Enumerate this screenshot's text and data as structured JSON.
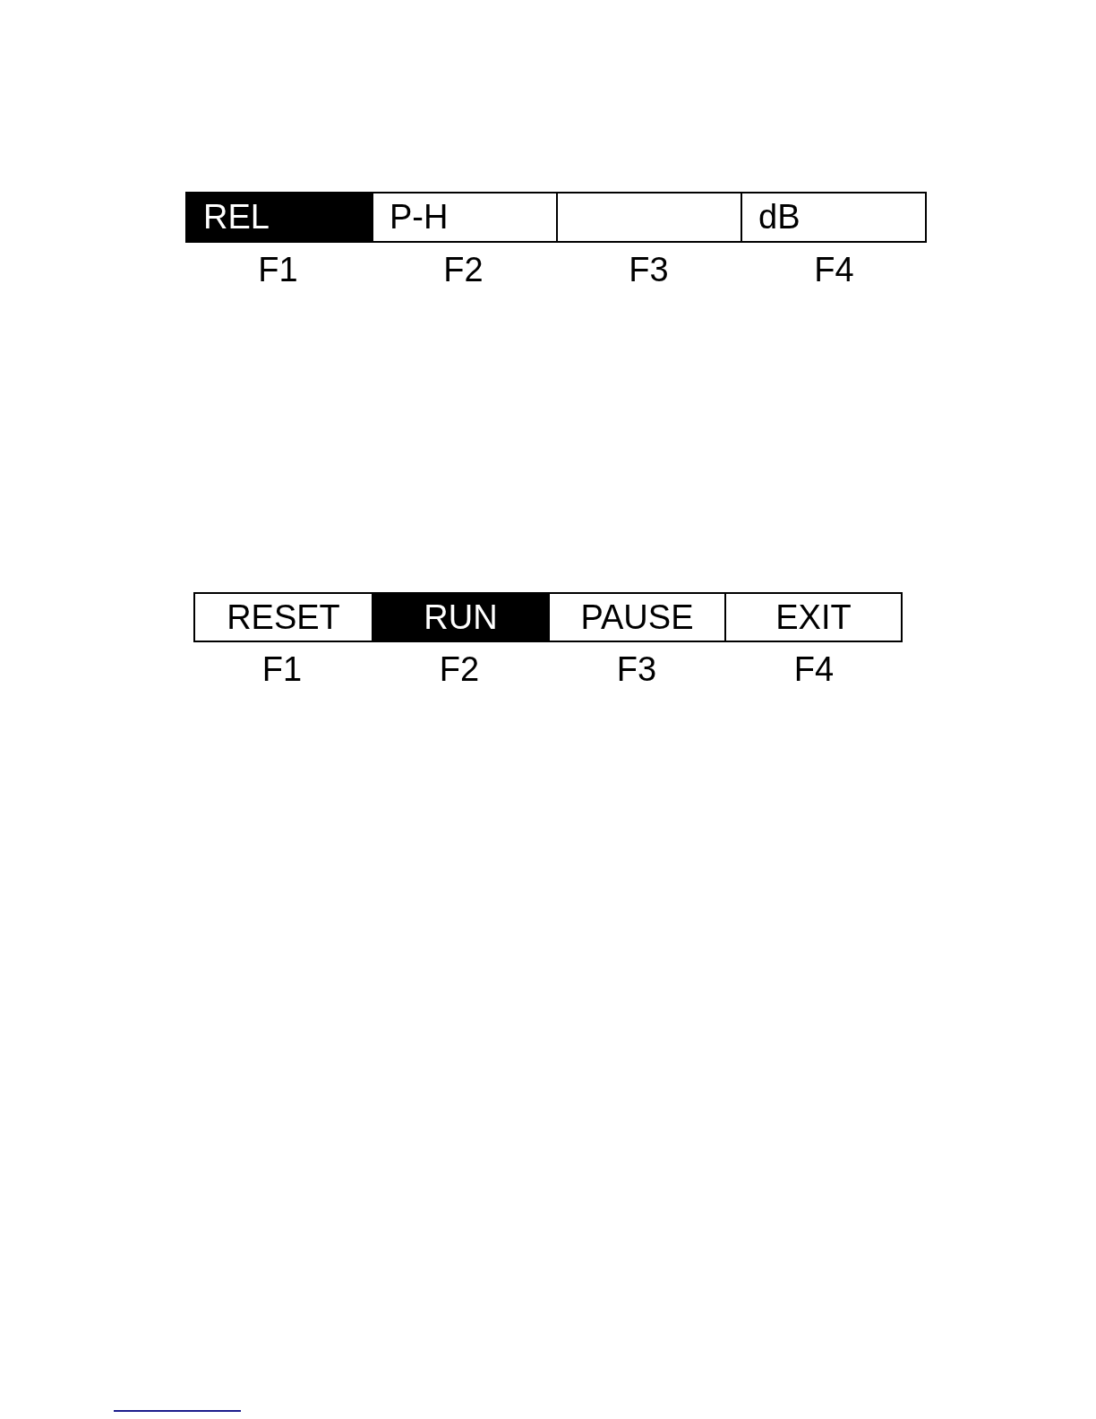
{
  "softkey_bars": [
    {
      "keys": [
        {
          "label": "REL",
          "key": "F1",
          "selected": true
        },
        {
          "label": "P-H",
          "key": "F2",
          "selected": false
        },
        {
          "key": "F3",
          "selected": false
        },
        {
          "label": "dB",
          "key": "F4",
          "selected": false
        }
      ]
    },
    {
      "keys": [
        {
          "label": "RESET",
          "key": "F1",
          "selected": false
        },
        {
          "label": "RUN",
          "key": "F2",
          "selected": true
        },
        {
          "label": "PAUSE",
          "key": "F3",
          "selected": false
        },
        {
          "label": "EXIT",
          "key": "F4",
          "selected": false
        }
      ]
    }
  ]
}
